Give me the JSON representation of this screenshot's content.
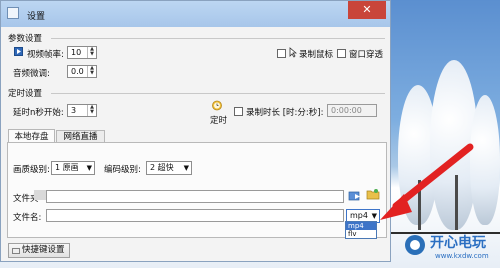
{
  "window": {
    "title": "设置",
    "close": "✕"
  },
  "params": {
    "section": "参数设置",
    "fps_label": "视频帧率:",
    "fps_value": "10",
    "audio_label": "音频微调:",
    "audio_value": "0.0",
    "record_cursor": "录制鼠标",
    "window_through": "窗口穿透"
  },
  "timer": {
    "section": "定时设置",
    "delay_label": "延时n秒开始:",
    "delay_value": "3",
    "timer_label": "定时",
    "record_duration": "录制时长 [时:分:秒]:",
    "duration_value": "0:00:00"
  },
  "tabs": [
    {
      "label": "本地存盘"
    },
    {
      "label": "网络直播"
    }
  ],
  "local": {
    "quality_label": "画质级别:",
    "quality_value": "1 原画",
    "encode_label": "编码级别:",
    "encode_value": "2 超快",
    "folder_label": "文件夹",
    "filename_label": "文件名:",
    "format_value": "mp4",
    "format_options": [
      "mp4",
      "flv"
    ]
  },
  "bottom": {
    "hotkey_button": "快捷键设置"
  },
  "watermark": {
    "brand": "开心电玩",
    "url": "www.kxdw.com"
  },
  "colors": {
    "accent": "#3d74c8",
    "arrow": "#e22222"
  }
}
